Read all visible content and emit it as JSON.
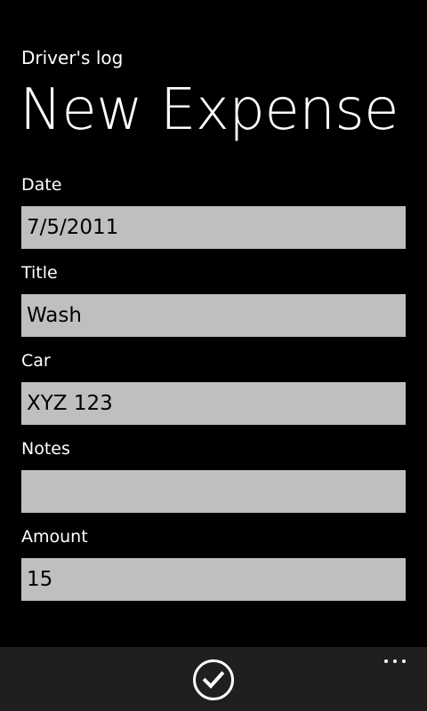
{
  "header": {
    "app_title": "Driver's log",
    "page_title": "New Expense"
  },
  "form": {
    "date": {
      "label": "Date",
      "value": "7/5/2011",
      "placeholder": ""
    },
    "title": {
      "label": "Title",
      "value": "Wash",
      "placeholder": ""
    },
    "car": {
      "label": "Car",
      "value": "XYZ 123",
      "placeholder": ""
    },
    "notes": {
      "label": "Notes",
      "value": "",
      "placeholder": ""
    },
    "amount": {
      "label": "Amount",
      "value": "15",
      "placeholder": ""
    }
  },
  "app_bar": {
    "save_icon": "check-circle-icon",
    "more_icon": "ellipsis-icon"
  },
  "colors": {
    "background": "#000000",
    "text": "#ffffff",
    "field_background": "#bfbfbf",
    "field_text": "#000000",
    "app_bar_background": "#1f1f1f"
  }
}
